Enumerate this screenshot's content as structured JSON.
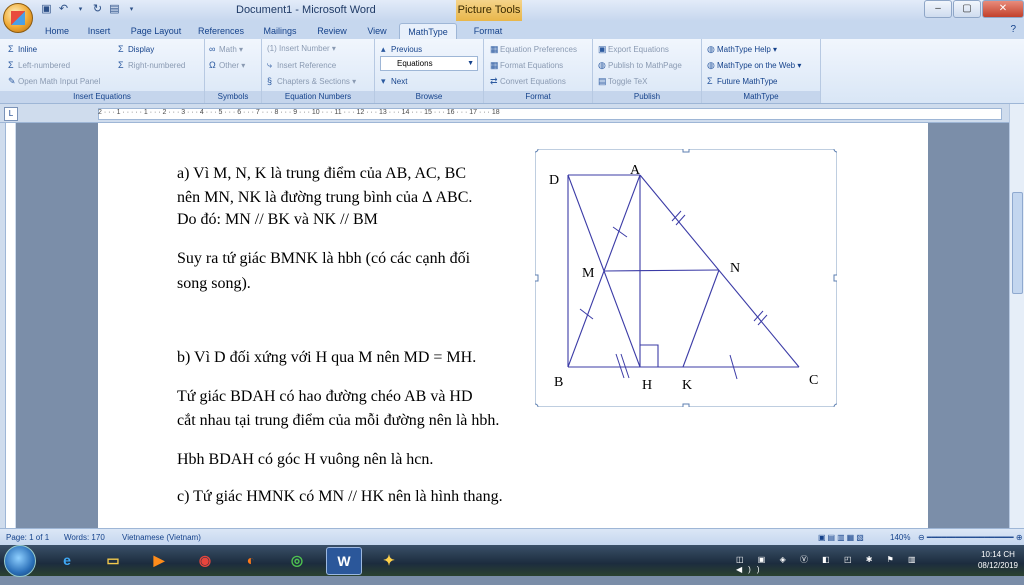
{
  "title_bar": {
    "document_title": "Document1 - Microsoft Word",
    "context_title": "Picture Tools"
  },
  "tabs": [
    "Home",
    "Insert",
    "Page Layout",
    "References",
    "Mailings",
    "Review",
    "View",
    "MathType",
    "Format"
  ],
  "active_tab": "MathType",
  "ribbon": {
    "insert_equations": {
      "label": "Insert Equations",
      "inline": "Inline",
      "display": "Display",
      "left_numbered": "Left-numbered",
      "right_numbered": "Right-numbered",
      "open_panel": "Open Math Input Panel"
    },
    "symbols": {
      "label": "Symbols",
      "math": "Math",
      "other": "Other"
    },
    "equation_numbers": {
      "label": "Equation Numbers",
      "insert_number": "(1) Insert Number",
      "insert_reference": "Insert Reference",
      "chapters_sections": "Chapters & Sections"
    },
    "browse": {
      "label": "Browse",
      "previous": "Previous",
      "combo_value": "Equations",
      "next": "Next"
    },
    "format": {
      "label": "Format",
      "equation_preferences": "Equation Preferences",
      "format_equations": "Format Equations",
      "convert_equations": "Convert Equations"
    },
    "publish": {
      "label": "Publish",
      "export_equations": "Export Equations",
      "publish_mathpage": "Publish to MathPage",
      "toggle_tex": "Toggle TeX"
    },
    "mathtype": {
      "label": "MathType",
      "help": "MathType Help",
      "on_web": "MathType on the Web",
      "future": "Future MathType"
    }
  },
  "ruler_ticks": "2 · · · 1 · · · · · 1 · · · 2 · · · 3 · · · 4 · · · 5 · · · 6 · · · 7 · · · 8 · · · 9 · · · 10 · · · 11 · · · 12 · · · 13 · · · 14 · · · 15 · · · 16 · · · 17 · · · 18",
  "document": {
    "para_a1": "a) Vì M, N, K là trung điểm của AB, AC, BC",
    "para_a2": "nên MN, NK là đường trung bình của  Δ  ABC.",
    "para_a3": "Do đó: MN // BK và NK // BM",
    "para_s1": "Suy ra tứ giác BMNK là hbh (có các cạnh đối",
    "para_s2": "song song).",
    "para_b1": "b) Vì D đối xứng với H qua M nên MD = MH.",
    "para_b2": "Tứ giác BDAH có hao đường chéo AB và HD",
    "para_b3": "cắt nhau tại trung điểm của mỗi đường nên là hbh.",
    "para_b4": "Hbh BDAH có góc H vuông nên là hcn.",
    "para_c1": "c) Tứ giác HMNK có MN // HK nên là hình thang."
  },
  "figure": {
    "labels": {
      "D": "D",
      "A": "A",
      "M": "M",
      "N": "N",
      "B": "B",
      "H": "H",
      "K": "K",
      "C": "C"
    }
  },
  "status_bar": {
    "page": "Page: 1 of 1",
    "words": "Words: 170",
    "language": "Vietnamese (Vietnam)",
    "zoom": "140%"
  },
  "taskbar": {
    "time": "10:14 CH",
    "date": "08/12/2019"
  }
}
